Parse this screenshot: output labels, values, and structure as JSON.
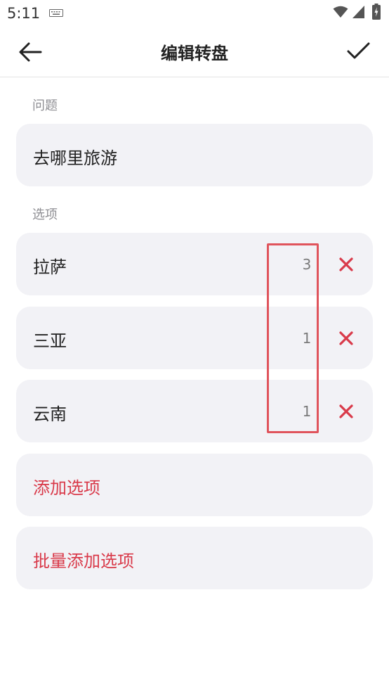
{
  "status_bar": {
    "time": "5:11",
    "icons": [
      "keyboard-icon",
      "wifi-icon",
      "signal-icon",
      "battery-icon"
    ]
  },
  "toolbar": {
    "title": "编辑转盘",
    "back_icon": "arrow-left-icon",
    "confirm_icon": "checkmark-icon"
  },
  "question": {
    "label": "问题",
    "value": "去哪里旅游"
  },
  "options": {
    "label": "选项",
    "items": [
      {
        "name": "拉萨",
        "weight": "3"
      },
      {
        "name": "三亚",
        "weight": "1"
      },
      {
        "name": "云南",
        "weight": "1"
      }
    ],
    "delete_icon": "close-x-icon"
  },
  "actions": {
    "add_option": "添加选项",
    "batch_add": "批量添加选项"
  },
  "colors": {
    "accent_red": "#d93a4a",
    "card_bg": "#f2f2f6",
    "highlight_border": "#e0545c"
  }
}
